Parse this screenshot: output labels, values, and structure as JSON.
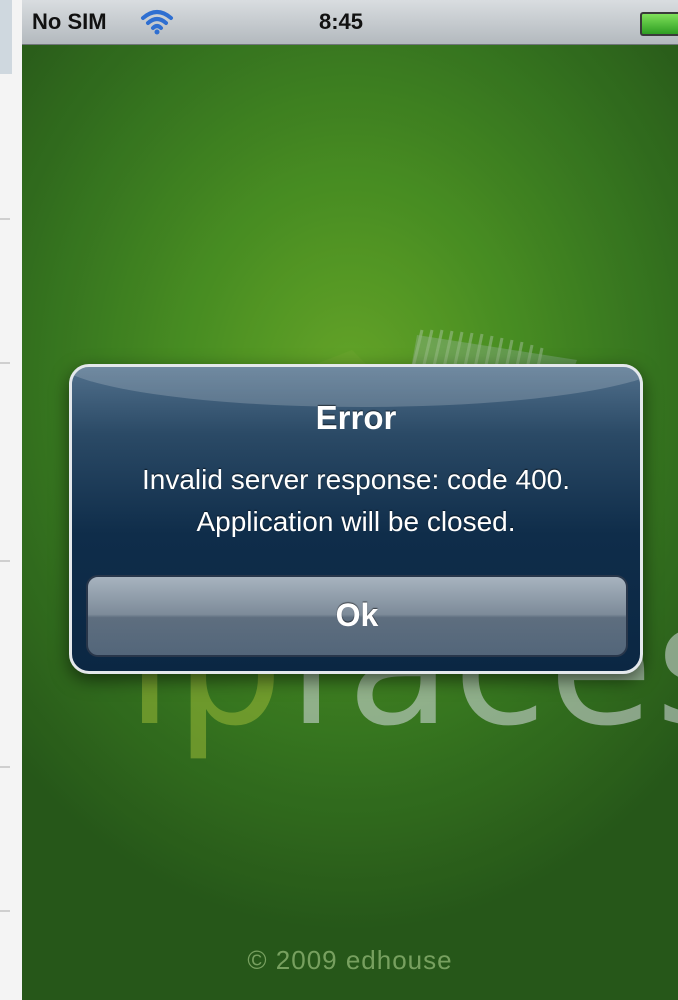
{
  "status_bar": {
    "carrier": "No SIM",
    "time": "8:45",
    "wifi_icon": "wifi-icon",
    "battery_icon": "battery-icon"
  },
  "background": {
    "logo_ip": "ip",
    "logo_faces": "faces",
    "copyright": "© 2009 edhouse"
  },
  "alert": {
    "title": "Error",
    "message": "Invalid server response: code  400.\nApplication will be closed.",
    "button_label": "Ok"
  },
  "colors": {
    "background_green": "#4f9a25",
    "alert_blue": "#0f2d4a",
    "status_bar_gray": "#b3b9be"
  }
}
